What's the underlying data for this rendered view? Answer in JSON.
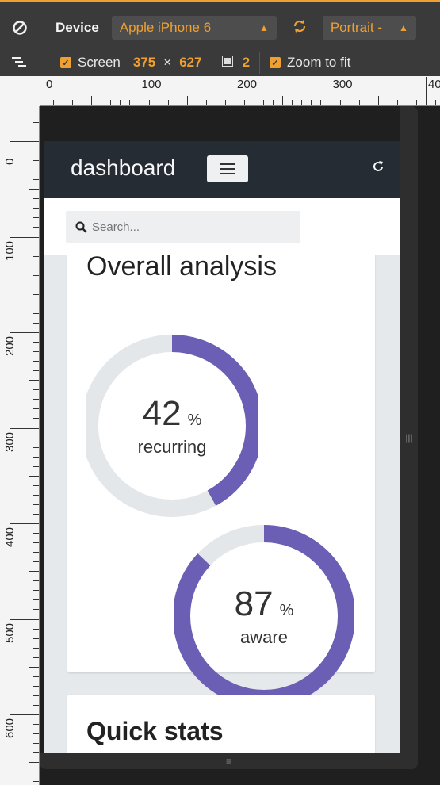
{
  "toolbar": {
    "device_label": "Device",
    "device_value": "Apple iPhone 6",
    "orientation_value": "Portrait -",
    "screen_label": "Screen",
    "screen_width": "375",
    "screen_times": "×",
    "screen_height": "627",
    "pixel_ratio": "2",
    "zoom_label": "Zoom to fit",
    "accent_color": "#f0a030"
  },
  "ruler": {
    "h_labels": [
      "0",
      "100",
      "200",
      "300",
      "40"
    ],
    "v_labels": [
      "0",
      "100",
      "200",
      "300",
      "400",
      "500",
      "600"
    ]
  },
  "app": {
    "brand": "dashboard",
    "search_placeholder": "Search...",
    "overall_title": "Overall analysis",
    "quick_stats_title": "Quick stats",
    "donuts": [
      {
        "value": "42",
        "unit": "%",
        "label": "recurring",
        "percent": 42
      },
      {
        "value": "87",
        "unit": "%",
        "label": "aware",
        "percent": 87
      }
    ],
    "donut_color": "#6b5fb5",
    "donut_track_color": "#e4e7ea"
  }
}
